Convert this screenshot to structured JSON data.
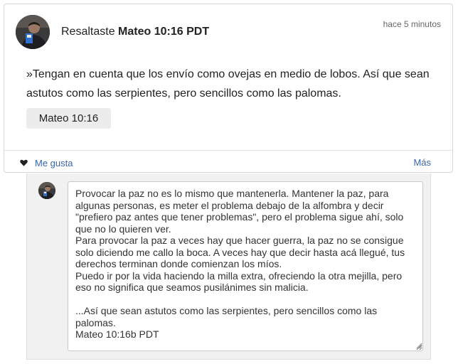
{
  "post": {
    "timestamp": "hace 5 minutos",
    "action_text": "Resaltaste ",
    "reference_bold": "Mateo 10:16 PDT",
    "quote": "»Tengan en cuenta que los envío como ovejas en medio de lobos. Así que sean astutos como las serpientes, pero sencillos como las palomas.",
    "reference_chip": "Mateo 10:16"
  },
  "actions": {
    "like_label": "Me gusta",
    "more_label": "Más"
  },
  "comment": {
    "text": "Provocar la paz no es lo mismo que mantenerla. Mantener la paz, para algunas personas, es meter el problema debajo de la alfombra y decir \"prefiero paz antes que tener problemas\", pero el problema sigue ahí, solo que no lo quieren ver.\nPara provocar la paz a veces hay que hacer guerra, la paz no se consigue solo diciendo me callo la boca. A veces hay que decir hasta acá llegué, tus derechos terminan donde comienzan los míos.\nPuedo ir por la vida haciendo la milla extra, ofreciendo la otra mejilla, pero eso no significa que seamos pusilánimes sin malicia.\n\n...Así que sean astutos como las serpientes, pero sencillos como las palomas.\nMateo 10:16b PDT"
  },
  "icons": {
    "like": "heart-icon",
    "resize": "resize-grip-icon"
  },
  "colors": {
    "link": "#3a66a8",
    "panel_bg": "#f1f1f1",
    "chip_bg": "#ececec"
  }
}
